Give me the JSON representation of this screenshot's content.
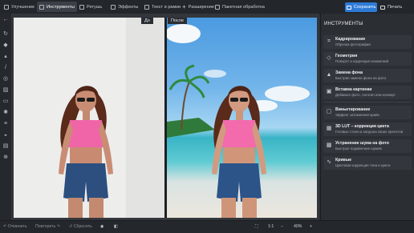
{
  "toolbar": {
    "items": [
      {
        "label": "Улучшение",
        "icon": "enhance-icon",
        "active": false
      },
      {
        "label": "Инструменты",
        "icon": "crop-icon",
        "active": true
      },
      {
        "label": "Ретушь",
        "icon": "brush-icon",
        "active": false
      },
      {
        "label": "Эффекты",
        "icon": "effects-icon",
        "active": false
      },
      {
        "label": "Текст и рамки",
        "icon": "text-icon",
        "active": false
      },
      {
        "label": "Разширение",
        "icon": "plus-icon",
        "active": false
      },
      {
        "label": "Пакетная обработка",
        "icon": "batch-icon",
        "active": false
      }
    ],
    "save_label": "Сохранить",
    "print_label": "Печать",
    "accent": "#2d7bd6"
  },
  "canvas": {
    "before_label": "До",
    "after_label": "После"
  },
  "panel": {
    "title": "ИНСТРУМЕНТЫ",
    "cards": [
      {
        "title": "Кадрирование",
        "subtitle": "Обрезка фотографии",
        "icon": "crop-icon"
      },
      {
        "title": "Геометрия",
        "subtitle": "Поворот и коррекция искажений",
        "icon": "geometry-icon"
      },
      {
        "title": "Замена фона",
        "subtitle": "Быстрая замена фона на фото",
        "icon": "background-replace-icon"
      },
      {
        "title": "Вставка картинки",
        "subtitle": "Добавьте фото, логотип или клипарт",
        "icon": "insert-image-icon"
      },
      {
        "title": "Виньетирование",
        "subtitle": "Эффект затемнения краёв",
        "icon": "vignette-icon"
      },
      {
        "title": "3D LUT – коррекция цвета",
        "subtitle": "Готовые стили и загрузка своих пресетов",
        "icon": "lut-icon"
      },
      {
        "title": "Устранение шума на фото",
        "subtitle": "Быстрое подавление шумов",
        "icon": "denoise-icon"
      },
      {
        "title": "Кривые",
        "subtitle": "Цветовая коррекция тона и цвета",
        "icon": "curves-icon"
      }
    ]
  },
  "bottom": {
    "undo_label": "Отменить",
    "redo_label": "Повторить",
    "reset_label": "Сбросить",
    "ratio_label": "1:1",
    "zoom_label": "40%",
    "zoom_fraction": 0.4
  }
}
